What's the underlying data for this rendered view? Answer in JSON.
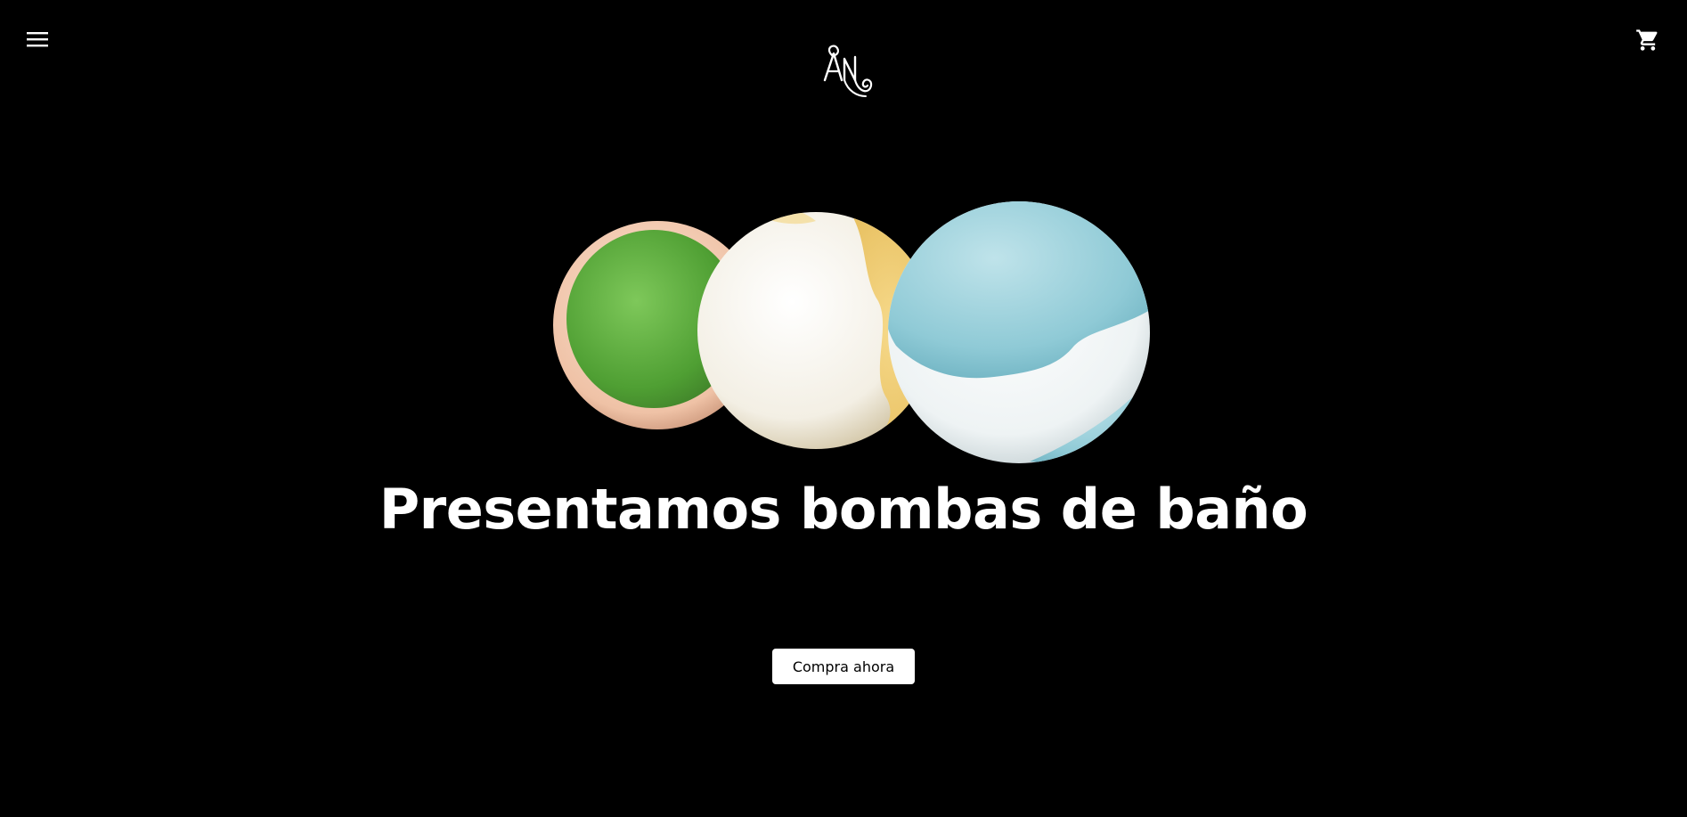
{
  "header": {
    "menu_icon": "hamburger-menu-icon",
    "cart_icon": "shopping-cart-icon",
    "logo_text": "AN"
  },
  "hero": {
    "headline": "Presentamos bombas de baño",
    "cta_label": "Compra ahora",
    "image_subject": "three bath bombs (green/peach, white/yellow, blue/white)"
  },
  "colors": {
    "background": "#000000",
    "text": "#ffffff",
    "button_bg": "#ffffff",
    "button_text": "#000000"
  }
}
